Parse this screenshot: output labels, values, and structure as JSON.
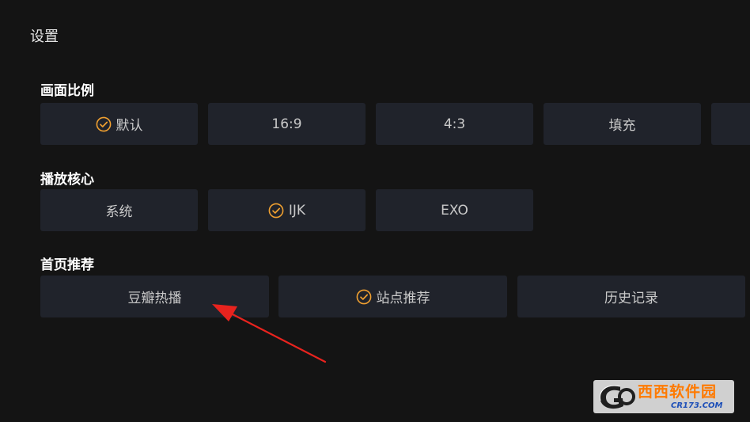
{
  "page": {
    "title": "设置"
  },
  "sections": [
    {
      "title": "画面比例",
      "options": [
        {
          "label": "默认",
          "selected": true
        },
        {
          "label": "16:9",
          "selected": false
        },
        {
          "label": "4:3",
          "selected": false
        },
        {
          "label": "填充",
          "selected": false
        },
        {
          "label": "",
          "selected": false
        }
      ]
    },
    {
      "title": "播放核心",
      "options": [
        {
          "label": "系统",
          "selected": false
        },
        {
          "label": "IJK",
          "selected": true
        },
        {
          "label": "EXO",
          "selected": false
        }
      ]
    },
    {
      "title": "首页推荐",
      "options": [
        {
          "label": "豆瓣热播",
          "selected": false
        },
        {
          "label": "站点推荐",
          "selected": true
        },
        {
          "label": "历史记录",
          "selected": false
        }
      ]
    }
  ],
  "icons": {
    "check": "check-circle-icon",
    "arrow": "red-arrow-annotation"
  },
  "colors": {
    "background": "#141414",
    "option_bg": "#20232b",
    "check_accent": "#f0a030",
    "arrow": "#e8231e"
  },
  "watermark": {
    "main": "西西软件园",
    "sub": "CR173.COM"
  }
}
